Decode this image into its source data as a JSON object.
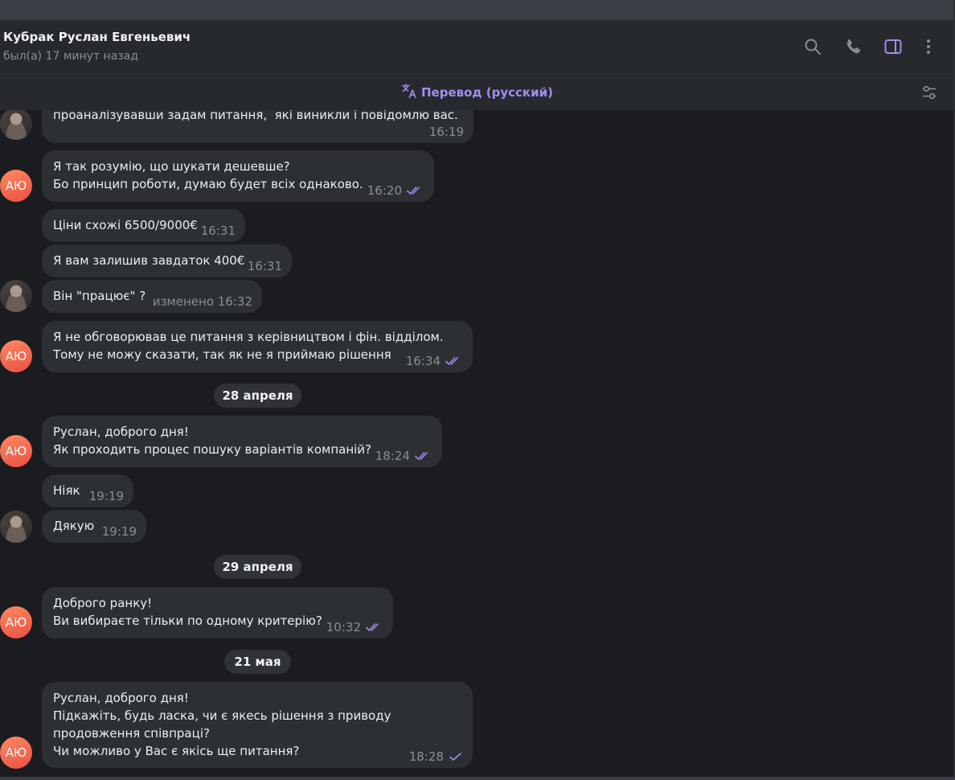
{
  "header": {
    "contact_name": "Кубрак Руслан Евгеньевич",
    "status": "был(а) 17 минут назад",
    "icons": [
      "search-icon",
      "phone-icon",
      "sidebar-toggle-icon",
      "more-vertical-icon"
    ]
  },
  "translate_bar": {
    "label": "Перевод (русский)",
    "icon": "translate-icon",
    "settings_icon": "filter-settings-icon"
  },
  "colors": {
    "accent": "#a28ef0",
    "bubble": "#2c3035",
    "background": "#1b1c20",
    "header": "#26292e",
    "avatar_gradient": [
      "#ff8a5f",
      "#ea4f45"
    ]
  },
  "avatar_initials": "АЮ",
  "messages": [
    {
      "text": "проаналізувавши задам питання,  які виникли і повідомлю вас.",
      "time": "16:19",
      "read": "none"
    },
    {
      "text": "Я так розумію, що шукати дешевше?\nБо принцип роботи, думаю будет всіх однаково.",
      "time": "16:20",
      "read": "double"
    },
    {
      "text": "Ціни схожі 6500/9000€",
      "time": "16:31",
      "read": "none"
    },
    {
      "text": "Я вам залишив завдаток 400€",
      "time": "16:31",
      "read": "none"
    },
    {
      "text": "Він \"працює\" ?",
      "time": "изменено 16:32",
      "read": "none"
    },
    {
      "text": "Я не обговорював це питання з керівництвом і фін. відділом.\nТому не можу сказати, так як не я приймаю рішення",
      "time": "16:34",
      "read": "double"
    },
    {
      "text": "Руслан, доброго дня!\nЯк проходить процес пошуку варіантів компаній?",
      "time": "18:24",
      "read": "double"
    },
    {
      "text": "Ніяк",
      "time": "19:19",
      "read": "none"
    },
    {
      "text": "Дякую",
      "time": "19:19",
      "read": "none"
    },
    {
      "text": "Доброго ранку!\nВи вибираєте тільки по одному критерію?",
      "time": "10:32",
      "read": "double"
    },
    {
      "text": "Руслан, доброго дня!\nПідкажіть, будь ласка, чи є якесь рішення з приводу\nпродовження співпраці?\nЧи можливо у Вас є якісь ще питання?",
      "time": "18:28",
      "read": "single"
    }
  ],
  "date_separators": [
    "28 апреля",
    "29 апреля",
    "21 мая"
  ]
}
